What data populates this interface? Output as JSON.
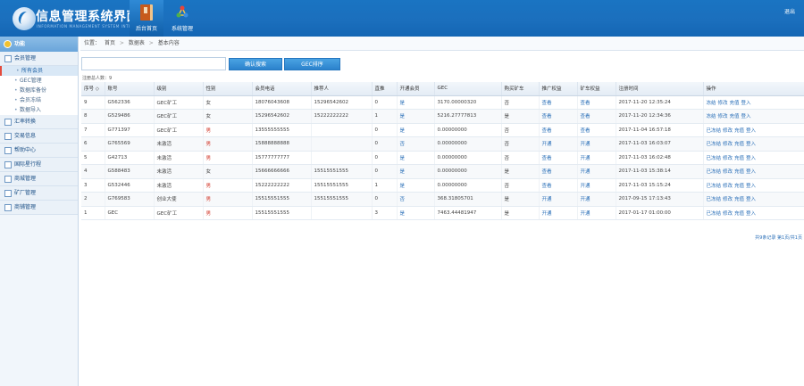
{
  "header": {
    "title": "信息管理系统界面",
    "subtitle": "INFORMATION MANAGEMENT SYSTEM INTERFACE",
    "nav": [
      {
        "label": "后台首页",
        "icon": "book-icon"
      },
      {
        "label": "系统管理",
        "icon": "network-icon"
      }
    ],
    "user": "退出"
  },
  "sidebar": {
    "head": "功能",
    "groups": [
      {
        "label": "会员管理",
        "subs": [
          "所有会员",
          "GEC管理",
          "数据库备份",
          "会员冻结",
          "数据导入"
        ]
      },
      {
        "label": "汇率转换"
      },
      {
        "label": "交易信息"
      },
      {
        "label": "帮助中心"
      },
      {
        "label": "国际星行程"
      },
      {
        "label": "商城管理"
      },
      {
        "label": "矿厂管理"
      },
      {
        "label": "商铺管理"
      }
    ]
  },
  "breadcrumb": [
    "位置：",
    "首页",
    "数据表",
    "基本内容"
  ],
  "search": {
    "placeholder": "",
    "btn_default": "确认搜索",
    "btn_gec": "GEC排序"
  },
  "count": "注册总人数：9",
  "table": {
    "headers": [
      "序号 ◇",
      "账号",
      "级别",
      "性别",
      "会员电话",
      "推荐人",
      "直推",
      "开通会员",
      "GEC",
      "购买矿车",
      "推广权益",
      "矿车权益",
      "注册时间",
      "操作"
    ],
    "rows": [
      [
        "9",
        "G562336",
        "GEC矿工",
        "女",
        "18076043608",
        "15296542602",
        "0",
        "是",
        "3170.00000320",
        "否",
        "查看",
        "查看",
        "2017-11-20 12:35:24",
        "冻结 修改 充值 登入"
      ],
      [
        "8",
        "G529486",
        "GEC矿工",
        "女",
        "15296542602",
        "15222222222",
        "1",
        "是",
        "5216.27777813",
        "是",
        "查看",
        "查看",
        "2017-11-20 12:34:36",
        "冻结 修改 充值 登入"
      ],
      [
        "7",
        "G771397",
        "GEC矿工",
        "男",
        "13555555555",
        "",
        "0",
        "是",
        "0.00000000",
        "否",
        "查看",
        "查看",
        "2017-11-04 16:57:18",
        "已冻结 修改 充值 登入"
      ],
      [
        "6",
        "G765569",
        "未激活",
        "男",
        "15888888888",
        "",
        "0",
        "否",
        "0.00000000",
        "否",
        "开通",
        "开通",
        "2017-11-03 16:03:07",
        "已冻结 修改 充值 登入"
      ],
      [
        "5",
        "G42713",
        "未激活",
        "男",
        "15777777777",
        "",
        "0",
        "是",
        "0.00000000",
        "否",
        "查看",
        "开通",
        "2017-11-03 16:02:48",
        "已冻结 修改 充值 登入"
      ],
      [
        "4",
        "G588483",
        "未激活",
        "女",
        "15666666666",
        "15515551555",
        "0",
        "是",
        "0.00000000",
        "是",
        "查看",
        "开通",
        "2017-11-03 15:38:14",
        "已冻结 修改 充值 登入"
      ],
      [
        "3",
        "G532446",
        "未激活",
        "男",
        "15222222222",
        "15515551555",
        "1",
        "是",
        "0.00000000",
        "否",
        "查看",
        "开通",
        "2017-11-03 15:15:24",
        "已冻结 修改 充值 登入"
      ],
      [
        "2",
        "G769583",
        "创业大使",
        "男",
        "15515551555",
        "15515551555",
        "0",
        "否",
        "368.31805701",
        "是",
        "开通",
        "开通",
        "2017-09-15 17:13:43",
        "已冻结 修改 充值 登入"
      ],
      [
        "1",
        "GEC",
        "GEC矿工",
        "男",
        "15515551555",
        "",
        "3",
        "是",
        "7463.44481947",
        "是",
        "开通",
        "开通",
        "2017-01-17 01:00:00",
        "已冻结 修改 充值 登入"
      ]
    ]
  },
  "pager": "共9条记录 第1页/共1页"
}
